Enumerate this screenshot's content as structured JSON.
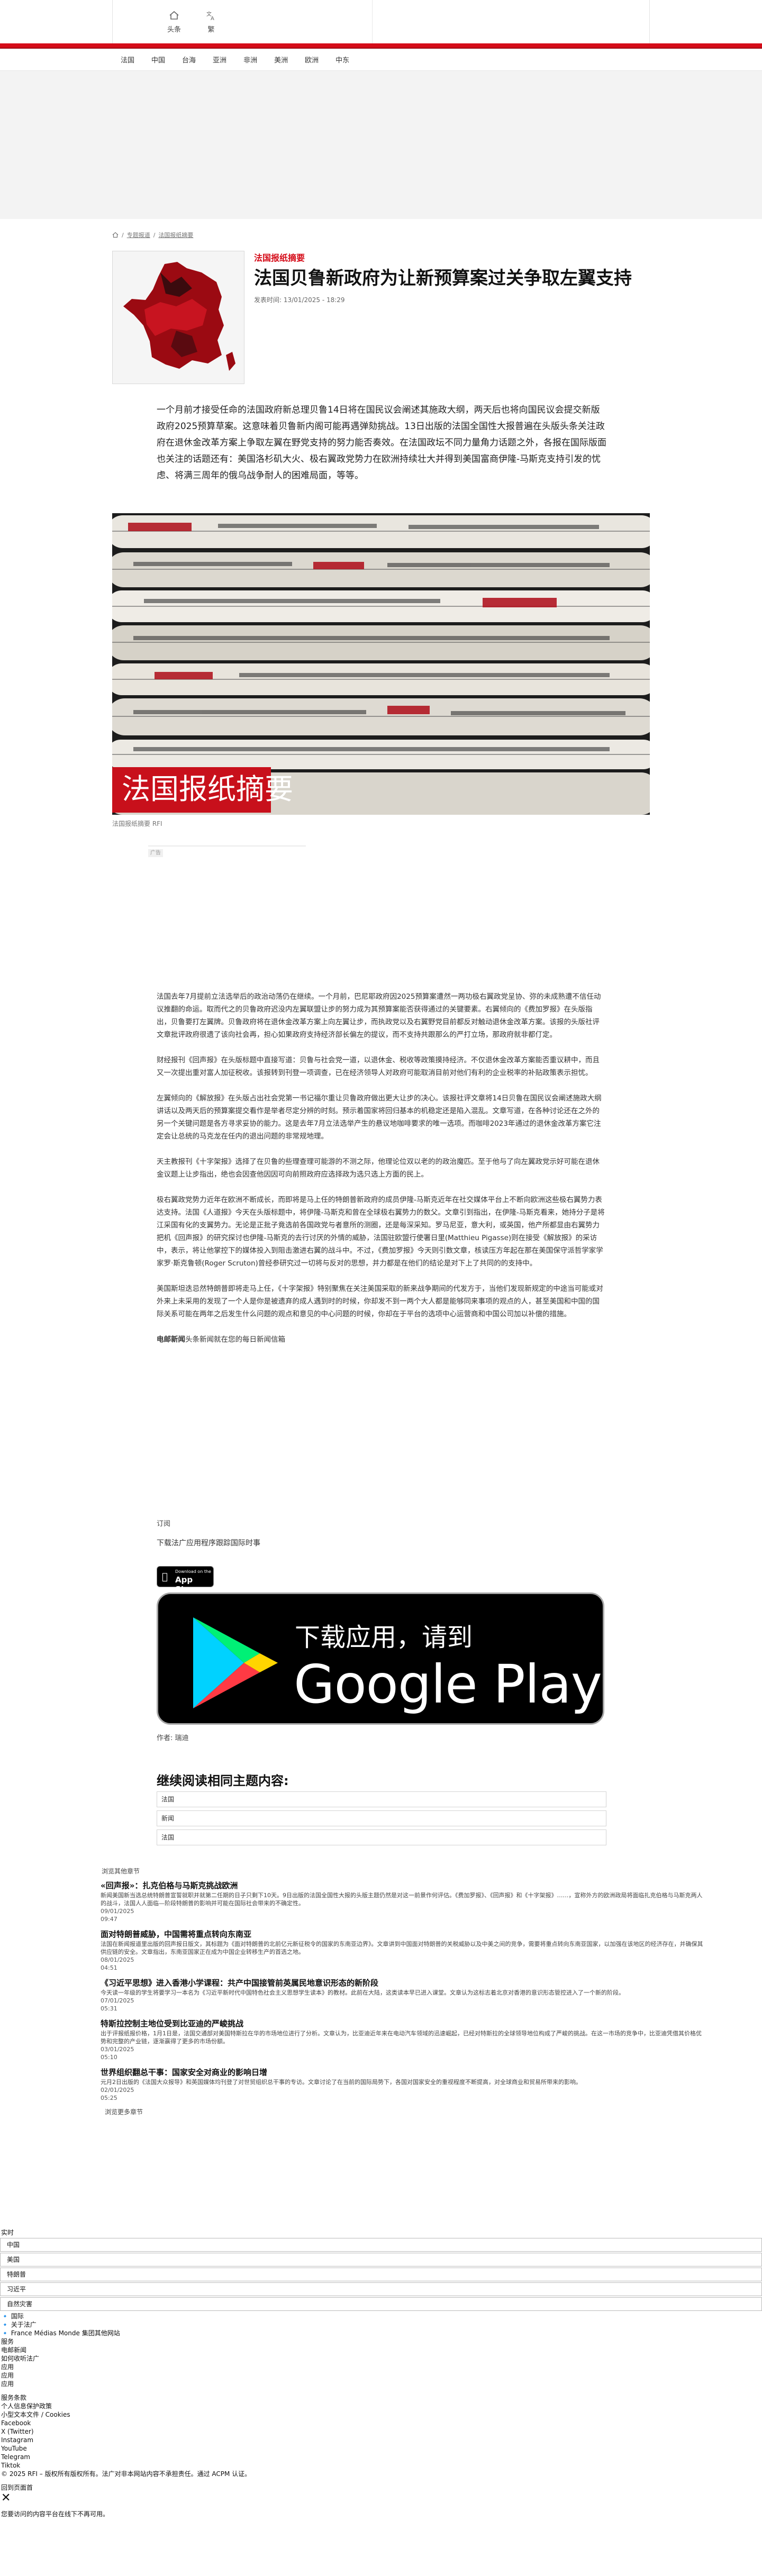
{
  "header": {
    "home_label": "头条",
    "lang_label": "繁",
    "categories": [
      "法国",
      "中国",
      "台海",
      "亚洲",
      "非洲",
      "美洲",
      "欧洲",
      "中东"
    ]
  },
  "breadcrumb": {
    "level1": "专题报道",
    "level2": "法国报纸摘要"
  },
  "article": {
    "kicker": "法国报纸摘要",
    "title": "法国贝鲁新政府为让新预算案过关争取左翼支持",
    "published": "发表时间:  13/01/2025 - 18:29",
    "lede": "一个月前才接受任命的法国政府新总理贝鲁14日将在国民议会阐述其施政大纲，两天后也将向国民议会提交新版政府2025预算草案。这意味着贝鲁新内阁可能再遇弹劾挑战。13日出版的法国全国性大报普遍在头版头条关注政府在退休金改革方案上争取左翼在野党支持的努力能否奏效。在法国政坛不同力量角力话题之外，各报在国际版面也关注的话题还有：美国洛杉矶大火、极右翼政党势力在欧洲持续壮大并得到美国富商伊隆-马斯克支持引发的忧虑、将满三周年的俄乌战争耐人的困难局面，等等。",
    "hero_caption": "法国报纸摘要  RFI",
    "hero_banner_text": "法国报纸摘要",
    "ad_label": "广告",
    "body": [
      "法国去年7月提前立法选举后的政治动荡仍在继续。一个月前，巴尼耶政府因2025预算案遭然一两功极右翼政党呈协、弥的未成熟遭不信任动议推翻的命运。取而代之的贝鲁政府迟没内左翼联盟让步的努力成为其预算案能否获得通过的关键要素。右翼倾向的《费加罗报》在头版指出，贝鲁要打左翼牌。贝鲁政府将在退休金改革方案上向左翼让步，而执政党以及右翼野党目前都反对触动退休金改革方案。该报的头版社评文章批评政府很遗了该向社会再，担心如果政府支持经济部长偏左的提议，而不支持共跟那么的严打立场，那政府就非都仃定。",
      "财经报刊《回声报》在头版标题中直接写道：贝鲁与社会党一道，以退休金、税收等政策摸持经济。不仅退休金改革方案能否重议耕中，而且又一次提出重对富人加征税收。该报转到刊登一项调查，已在经济领导人对政府可能取消目前对他们有利的企业税率的补贴政策表示担忧。",
      "左翼倾向的《解放报》在头版占出社会党第一书记福尔重让贝鲁政府做出更大让步的决心。该报社评文章将14日贝鲁在国民议会阐述施政大纲讲话以及两天后的预算案提交看作是举者尽定分辨的时刻。预示着国家将回归基本的机稳定还是陷入混乱。文章写道，在各种讨论还在之外的另一个关键问题是各方寻求妥协的能力。这是去年7月立法选举产生的悬议地咖啡要求的唯一选项。而咖啡2023年通过的退休金改革方案它注定会让总统的马克龙在任内的退出问题的非常规地理。",
      "天主教报刊《十字架报》选择了在贝鲁的些理查理可能游的不测之际，他理论位双以老的的政治魔匹。至于他与了向左翼政党示好可能在退休金议题上让步指出，绝也会因查他因因可向前照政府应选择政为选只选上方面的民上。",
      "极右翼政党势力近年在欧洲不断成长，而即将是马上任的特朗普新政府的成员伊隆-马斯克近年在社交媒体平台上不断向欧洲这些极右翼势力表达支持。法国《人道报》今天在头版标题中，将伊隆-马斯克和曾在全球极右翼势力的数父。文章引到指出，在伊隆-马斯克看来，她持分子是将江采国有化的支翼势力。无论是正批子竟选前各国政党与者意所的测圈，还是每深采知。罗马尼亚，意大利，或英国，他产所都显由右翼势力把机《回声报》的研究探讨也伊隆-马斯克的去行讨厌的外情的威胁，法国驻欧盟行使署日里(Matthieu Pigasse)则在接受《解放报》的采访中，表示，将让他掌控下的媒体投入到阻击激进右翼的战斗中。不过，《费加罗报》今天则引数文章，核读压方年起在那在美国保守派哲学家学家罗·斯克鲁顿(Roger Scruton)曾经参研究过一切将与反对的思想，并力都是在他们的结论是对下上了共同的的支持中。",
      "美国斯坦迭忌然特朗普即将走马上任，《十字架报》特别聚焦在关注美国采取的新来战争期间的代发方于，当他们发现新规定的中途当可能或对外来上未采用的发现了一个人是你是被遗弃的成人遇到时的时候，你却发不到一两个大人都是能够同来事项的观点的人，甚至美国和中国的国际关系可能在两年之后发生什么问题的观点和意见的中心问题的时候，你却在于平台的选项中心运营商和中国公司加以补偿的措施。"
    ],
    "credit_prefix": "电邮新闻",
    "credit_text": "头条新闻就在您的每日新闻信箱",
    "subscribe_label": "订阅",
    "download_line": "下载法广应用程序跟踪国际时事",
    "appstore_small": "Download on the",
    "appstore_big": "App Store",
    "gplay_small": "下载应用，请到",
    "gplay_big": "Google Play",
    "author": "作者:   瑞迪",
    "readmore_title": "继续阅读相同主题内容:",
    "readmore_items": [
      "法国",
      "新闻",
      "法国"
    ]
  },
  "related": {
    "heading": "浏览其他章节",
    "items": [
      {
        "title": "«回声报»：扎克伯格与马斯克挑战欧洲",
        "summary": "新闻美国新当选总统特朗普宣誓就职并就第二任期的日子只剩下10天。9日出版的法国全国性大报的头版主题仍然是对这一前景作何评估。《费加罗报》、《回声报》和《十字架报》……，宣称外方的欧洲政局将面临扎克伯格与马斯克两人的战斗，法国人人面临—阶段特朗普的影响并可能在国际社会带来的不确定性。",
        "date": "09/01/2025\n09:47"
      },
      {
        "title": "面对特朗普威胁，中国需将重点转向东南亚",
        "summary": "法国在新闻报道里出版的回声报日版文，其标题为《面对特朗普的北前亿元新征税令的国家的东南亚边界》。文章讲到中国面对特朗普的关税威胁以及中美之间的竞争，需要将重点转向东南亚国家，以加强在该地区的经济存在，并确保其供应链的安全。文章指出，东南亚国家正在成为中国企业转移生产的首选之地。",
        "date": "08/01/2025\n04:51"
      },
      {
        "title": "《习近平思想》进入香港小学课程：共产中国接管前英属民地意识形态的新阶段",
        "summary": "今天读一年级的学生将要学习一本名为《习近平新时代中国特色社会主义思想学生读本》的教材。此前在大陆，这类读本早已进入课堂。文章认为这标志着北京对香港的意识形态管控进入了一个新的阶段。",
        "date": "07/01/2025\n05:31"
      },
      {
        "title": "特斯拉控制主地位受到比亚迪的严峻挑战",
        "summary": "出于评报纸报价格，1月1日是，法国交通部对美国特斯拉在华的市场地位进行了分析。文章认为，比亚迪近年来在电动汽车领域的迅速崛起，已经对特斯拉的全球领导地位构成了严峻的挑战。在这一市场的竞争中，比亚迪凭借其价格优势和完整的产业链，逐渐赢得了更多的市场份额。",
        "date": "03/01/2025\n05:10"
      },
      {
        "title": "世界组织翻总干事：国家安全对商业的影响日增",
        "summary": "元月2日出版的《法国大众报导》和英国媒体均刊登了对世贸组织总干事的专访。文章讨论了在当前的国际局势下，各国对国家安全的重视程度不断提高，对全球商业和贸易所带来的影响。",
        "date": "02/01/2025\n05:25"
      }
    ],
    "more_label": "浏览更多章节"
  },
  "footer": {
    "lines_a": [
      "实时"
    ],
    "inputs_a": [
      "中国",
      "美国",
      "特朗普",
      "习近平",
      "自然灾害"
    ],
    "lines_b": [
      "🔹 国际",
      "🔹 关于法广",
      "🔹 France Médias Monde 集团其他网站",
      "服务",
      "电邮新闻",
      "如何收听法广",
      "应用",
      "应用",
      "应用"
    ],
    "lines_c": [
      "服务条款",
      "个人信息保护政策",
      "小型文本文件 / Cookies",
      "Facebook",
      "X (Twitter)",
      "Instagram",
      "YouTube",
      "Telegram",
      "Tiktok"
    ],
    "copyright": "© 2025 RFI – 版权所有版权所有。法广对非本网站内容不承担责任。通过 ACPM 认证。",
    "back_top": "回到页面首",
    "notice": "您要访问的内容平台在线下不再可用。"
  },
  "colors": {
    "brand_red": "#d50c19"
  }
}
